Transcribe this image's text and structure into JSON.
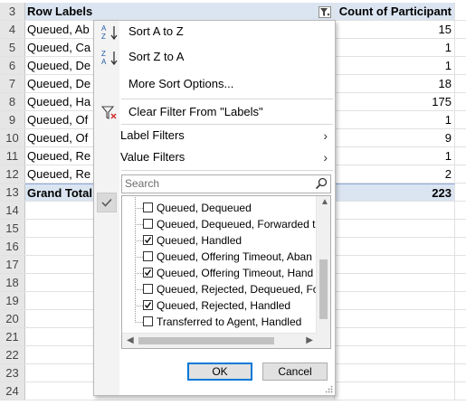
{
  "sheet": {
    "header": {
      "row": "3",
      "col_a": "Row Labels",
      "col_b": "Count of Participant"
    },
    "rows": [
      {
        "num": "4",
        "a": "Queued, Ab",
        "b": "15"
      },
      {
        "num": "5",
        "a": "Queued, Ca",
        "b": "1"
      },
      {
        "num": "6",
        "a": "Queued, De",
        "b": "1"
      },
      {
        "num": "7",
        "a": "Queued, De",
        "b": "18"
      },
      {
        "num": "8",
        "a": "Queued, Ha",
        "b": "175"
      },
      {
        "num": "9",
        "a": "Queued, Of",
        "b": "1"
      },
      {
        "num": "10",
        "a": "Queued, Of",
        "b": "9"
      },
      {
        "num": "11",
        "a": "Queued, Re",
        "b": "1"
      },
      {
        "num": "12",
        "a": "Queued, Re",
        "b": "2"
      }
    ],
    "total": {
      "num": "13",
      "a": "Grand Total",
      "b": "223"
    },
    "empty_rows": [
      "14",
      "15",
      "16",
      "17",
      "18",
      "19",
      "20",
      "21",
      "22",
      "23",
      "24"
    ]
  },
  "menu": {
    "sort_asc": "Sort A to Z",
    "sort_desc": "Sort Z to A",
    "more_sort": "More Sort Options...",
    "clear_filter": "Clear Filter From \"Labels\"",
    "label_filters": "Label Filters",
    "value_filters": "Value Filters",
    "search_placeholder": "Search",
    "items": [
      {
        "label": "Queued, Dequeued",
        "checked": false
      },
      {
        "label": "Queued, Dequeued, Forwarded to",
        "checked": false
      },
      {
        "label": "Queued, Handled",
        "checked": true
      },
      {
        "label": "Queued, Offering Timeout, Aban",
        "checked": false
      },
      {
        "label": "Queued, Offering Timeout, Hand",
        "checked": true
      },
      {
        "label": "Queued, Rejected, Dequeued, For",
        "checked": false
      },
      {
        "label": "Queued, Rejected, Handled",
        "checked": true
      },
      {
        "label": "Transferred to Agent, Handled",
        "checked": false
      }
    ],
    "ok_label": "OK",
    "cancel_label": "Cancel"
  },
  "colors": {
    "header_fill": "#dbe5f1",
    "accent": "#217346",
    "focus": "#0078d7"
  }
}
